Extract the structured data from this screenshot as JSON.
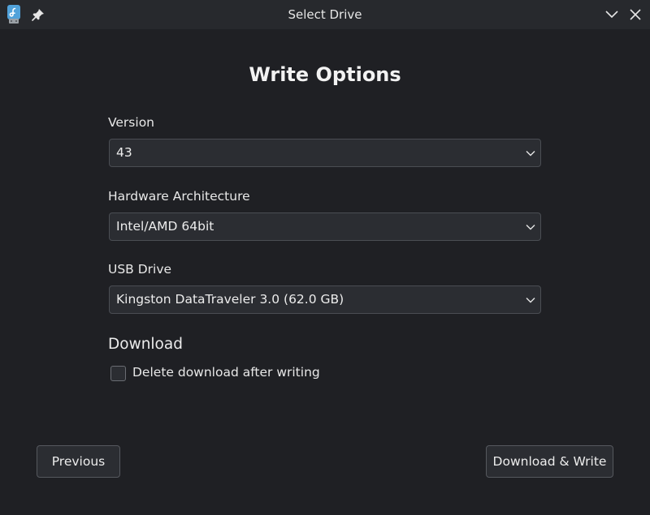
{
  "titlebar": {
    "title": "Select Drive",
    "app_icon": "fedora-logo-icon",
    "pin_icon": "pin-icon",
    "minimize_icon": "chevron-down-icon",
    "close_icon": "close-icon"
  },
  "main": {
    "heading": "Write Options",
    "version": {
      "label": "Version",
      "value": "43"
    },
    "architecture": {
      "label": "Hardware Architecture",
      "value": "Intel/AMD 64bit"
    },
    "usb_drive": {
      "label": "USB Drive",
      "value": "Kingston DataTraveler 3.0 (62.0 GB)"
    },
    "download": {
      "section_title": "Download",
      "delete_after_label": "Delete download after writing",
      "delete_after_checked": false
    }
  },
  "footer": {
    "previous_label": "Previous",
    "next_label": "Download & Write"
  },
  "colors": {
    "background": "#1f2024",
    "titlebar": "#27292d",
    "control": "#2b2d32",
    "border": "#4a4d53",
    "fedora_blue": "#51a2da"
  }
}
